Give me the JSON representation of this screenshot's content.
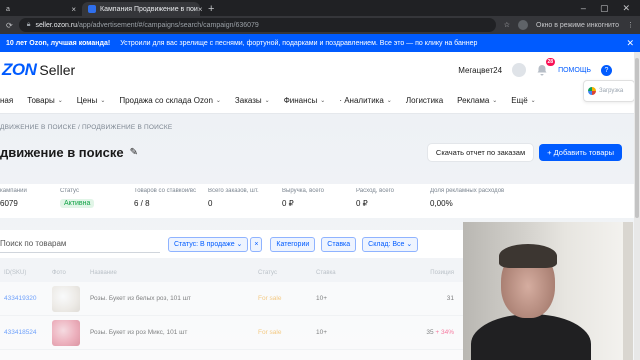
{
  "browser": {
    "tabs": [
      {
        "label": "а"
      },
      {
        "label": "Кампания Продвижение в пои"
      }
    ],
    "new_tab": "+",
    "url_host": "seller.ozon.ru",
    "url_path": "/app/advertisement/#/campaigns/search/campaign/636079",
    "incognito_label": "Окно в режиме инкогнито"
  },
  "banner": {
    "bold": "10 лет Ozon, лучшая команда!",
    "text": "Устроили для вас зрелище с песнями, фортуной, подарками и поздравлением. Все это — по клику на баннер"
  },
  "header": {
    "logo_oz": "ZON",
    "logo_seller": "Seller",
    "company": "Мегацвет24",
    "notifications": "28",
    "help": "ПОМОЩЬ",
    "help_icon": "?"
  },
  "nav": {
    "items": [
      {
        "label": "ная"
      },
      {
        "label": "Товары",
        "chev": "⌄"
      },
      {
        "label": "Цены",
        "chev": "⌄"
      },
      {
        "label": "Продажа со склада Ozon",
        "chev": "⌄"
      },
      {
        "label": "Заказы",
        "chev": "⌄"
      },
      {
        "label": "Финансы",
        "chev": "⌄"
      },
      {
        "label": "· Аналитика",
        "chev": "⌄"
      },
      {
        "label": "Логистика"
      },
      {
        "label": "Реклама",
        "chev": "⌄"
      },
      {
        "label": "Ещё",
        "chev": "⌄"
      }
    ],
    "widget_label": "Загрузка"
  },
  "page": {
    "breadcrumb": "ДВИЖЕНИЕ В ПОИСКЕ  /  ПРОДВИЖЕНИЕ В ПОИСКЕ",
    "title": "движение в поиске",
    "report_button": "Скачать отчет по заказам",
    "add_button": "+  Добавить товары"
  },
  "stats": [
    {
      "label": "кампании",
      "value": "6079"
    },
    {
      "label": "Статус",
      "value": "Активна",
      "badge": true
    },
    {
      "label": "Товаров со ставкой/все",
      "value": "6 / 8"
    },
    {
      "label": "Всего заказов, шт.",
      "value": "0"
    },
    {
      "label": "Выручка, всего",
      "value": "0 ₽"
    },
    {
      "label": "Расход, всего",
      "value": "0 ₽"
    },
    {
      "label": "Доля рекламных расходов",
      "value": "0,00%"
    }
  ],
  "filters": {
    "search_placeholder": "Поиск по товарам",
    "status_chip": "Статус: В продаже  ⌄",
    "status_chip_close": "×",
    "categories": "Категории",
    "bid": "Ставка",
    "warehouse": "Склад: Все  ⌄"
  },
  "table": {
    "headers": [
      "ID(SKU)",
      "Фото",
      "Название",
      "Статус",
      "Ставка",
      "Позиция"
    ],
    "rows": [
      {
        "id": "433419320",
        "name": "Розы. Букет из белых роз, 101 шт",
        "status": "For sale",
        "bid": "10+",
        "pos": "31",
        "delta": ""
      },
      {
        "id": "433418524",
        "name": "Розы. Букет из роз Микс, 101 шт",
        "status": "For sale",
        "bid": "10+",
        "pos": "35",
        "delta": "+ 34%"
      }
    ]
  },
  "colors": {
    "brand": "#005bff",
    "success": "#10a245",
    "alert": "#f91155"
  }
}
